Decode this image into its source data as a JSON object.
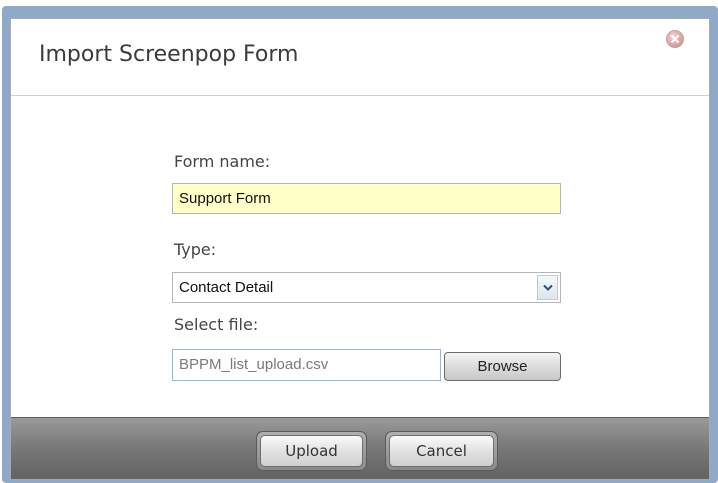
{
  "dialog": {
    "title": "Import Screenpop Form",
    "close_icon": "close-circle-icon"
  },
  "form": {
    "form_name": {
      "label": "Form name:",
      "value": "Support Form"
    },
    "type": {
      "label": "Type:",
      "selected": "Contact Detail",
      "arrow_icon": "chevron-down-icon"
    },
    "file": {
      "label": "Select file:",
      "value": "BPPM_list_upload.csv",
      "browse_label": "Browse"
    }
  },
  "footer": {
    "upload_label": "Upload",
    "cancel_label": "Cancel"
  },
  "colors": {
    "dialog_frame": "#8eaac8",
    "form_name_highlight": "#ffffc8",
    "footer_bar": "#7a7a7a"
  }
}
